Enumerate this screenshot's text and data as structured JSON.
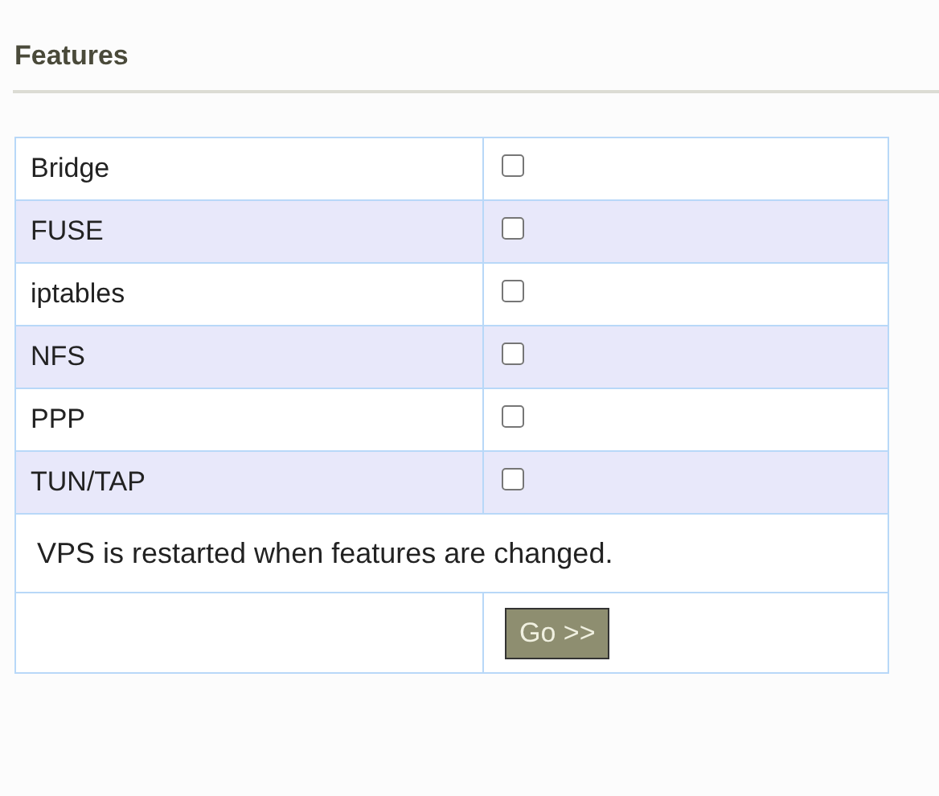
{
  "heading": "Features",
  "features": [
    {
      "name": "Bridge",
      "checked": false
    },
    {
      "name": "FUSE",
      "checked": false
    },
    {
      "name": "iptables",
      "checked": false
    },
    {
      "name": "NFS",
      "checked": false
    },
    {
      "name": "PPP",
      "checked": false
    },
    {
      "name": "TUN/TAP",
      "checked": false
    }
  ],
  "note": "VPS is restarted when features are changed.",
  "submit": "Go >>"
}
